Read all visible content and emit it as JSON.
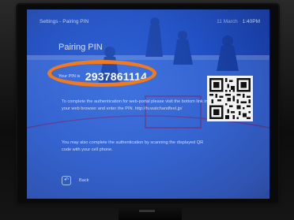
{
  "header": {
    "breadcrumb": "Settings - Pairing PIN",
    "date": "11 March",
    "time": "1:40PM"
  },
  "page": {
    "title": "Pairing PIN"
  },
  "pin": {
    "label": "Your PIN is",
    "value": "2937861114"
  },
  "instructions": {
    "paragraph1": "To complete the authentication for web-portal please visit the bottom link in your web browser and enter the PIN. http://tv.watchandfeel.jp/",
    "paragraph2": "You may also complete the authentication by scanning the displayed QR code with your cell phone."
  },
  "footer": {
    "back_label": "Back",
    "back_icon": "back-arrow-icon"
  },
  "colors": {
    "screen_blue": "#1f4fc4",
    "highlight_orange": "#f07a1e"
  }
}
